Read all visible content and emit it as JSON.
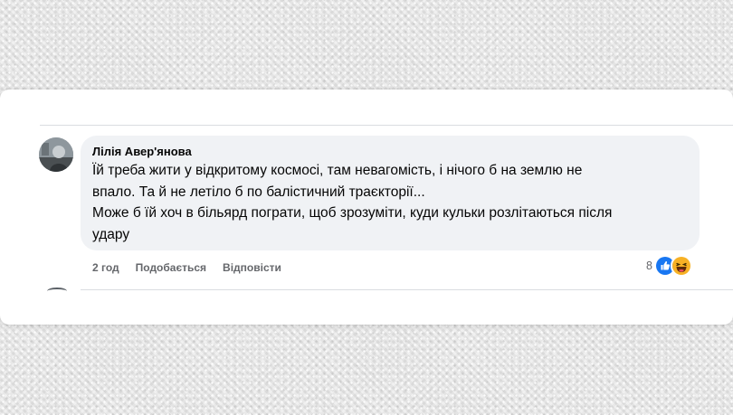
{
  "comment": {
    "author": "Лілія Авер'янова",
    "text": "Їй треба жити у відкритому космосі, там невагомість, і нічого б на землю не\nвпало. Та й не летіло б по балістичний траєкторії...\nМоже б їй хоч в більярд пограти, щоб зрозуміти, куди кульки розлітаються після\nудару",
    "timestamp": "2 год",
    "like_label": "Подобається",
    "reply_label": "Відповісти",
    "reaction_count": "8",
    "reaction_icons": [
      "like-icon",
      "haha-icon"
    ]
  },
  "colors": {
    "bubble_bg": "#f0f2f5",
    "like_blue": "#1877f2",
    "haha_yellow": "#f7b125",
    "secondary_text": "#65676b"
  }
}
